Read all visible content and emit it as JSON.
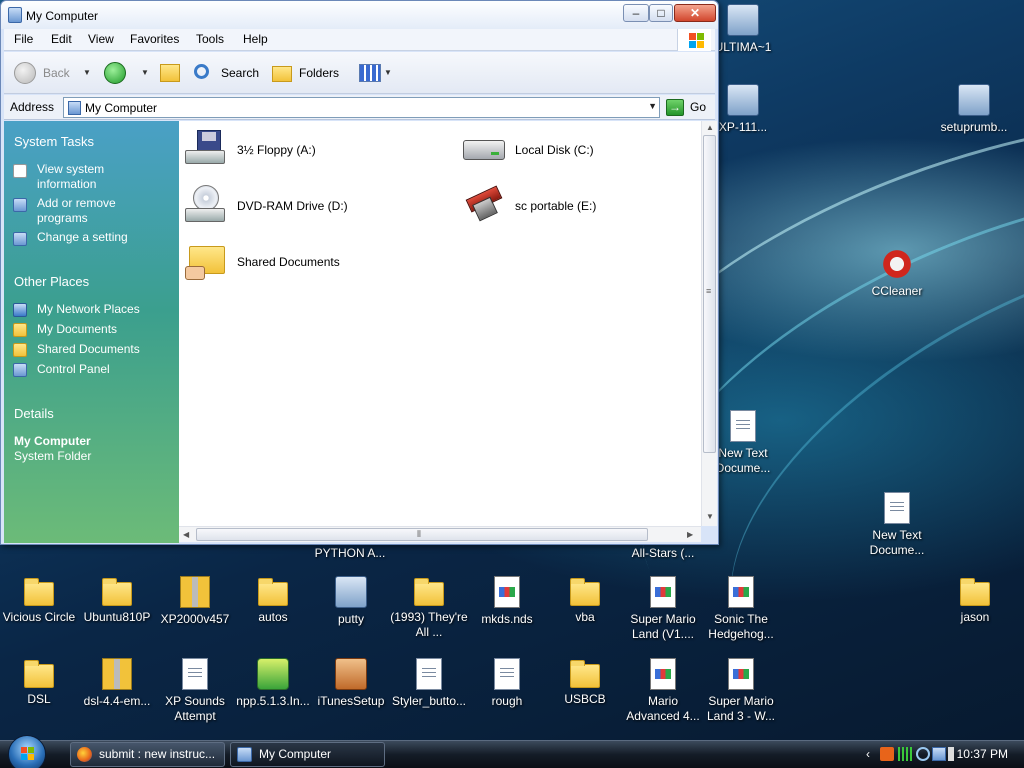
{
  "window": {
    "title": "My Computer",
    "controls": {
      "minimize": "–",
      "maximize": "□",
      "close": "✕"
    }
  },
  "menubar": [
    "File",
    "Edit",
    "View",
    "Favorites",
    "Tools",
    "Help"
  ],
  "toolbar": {
    "back": "Back",
    "search": "Search",
    "folders": "Folders"
  },
  "address": {
    "label": "Address",
    "value": "My Computer",
    "go": "Go"
  },
  "taskpane": {
    "system_tasks": {
      "title": "System Tasks",
      "items": [
        "View system information",
        "Add or remove programs",
        "Change a setting"
      ]
    },
    "other_places": {
      "title": "Other Places",
      "items": [
        "My Network Places",
        "My Documents",
        "Shared Documents",
        "Control Panel"
      ]
    },
    "details": {
      "title": "Details",
      "name": "My Computer",
      "type": "System Folder"
    }
  },
  "drives": [
    {
      "label": "3½ Floppy (A:)",
      "icon": "floppy-drive-icon"
    },
    {
      "label": "Local Disk (C:)",
      "icon": "hard-disk-icon"
    },
    {
      "label": "DVD-RAM Drive (D:)",
      "icon": "dvd-drive-icon"
    },
    {
      "label": "sc portable (E:)",
      "icon": "portable-drive-icon"
    },
    {
      "label": "Shared Documents",
      "icon": "shared-folder-icon"
    }
  ],
  "desktop_icons": {
    "right": [
      "ULTIMA~1",
      "XP-111...",
      "setuprumb...",
      "CCleaner",
      "New Text Docume...",
      "New Text Docume..."
    ],
    "partial": [
      "PYTHON A...",
      "All-Stars (..."
    ],
    "row1": [
      "Vicious Circle",
      "Ubuntu810P",
      "XP2000v457",
      "autos",
      "putty",
      "(1993) They're All ...",
      "mkds.nds",
      "vba",
      "Super Mario Land (V1....",
      "Sonic The Hedgehog...",
      "jason"
    ],
    "row2": [
      "DSL",
      "dsl-4.4-em...",
      "XP Sounds Attempt",
      "npp.5.1.3.In...",
      "iTunesSetup",
      "Styler_butto...",
      "rough",
      "USBCB",
      "Mario Advanced 4...",
      "Super Mario Land 3 - W..."
    ]
  },
  "taskbar": {
    "tasks": [
      "submit : new instruc...",
      "My Computer"
    ],
    "clock": "10:37 PM"
  }
}
